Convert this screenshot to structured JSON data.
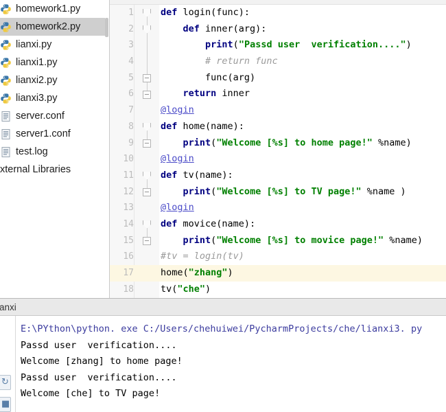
{
  "sidebar": {
    "items": [
      {
        "label": "homework1.py",
        "icon": "python-file-icon",
        "selected": false
      },
      {
        "label": "homework2.py",
        "icon": "python-file-icon",
        "selected": true
      },
      {
        "label": "lianxi.py",
        "icon": "python-file-icon",
        "selected": false
      },
      {
        "label": "lianxi1.py",
        "icon": "python-file-icon",
        "selected": false
      },
      {
        "label": "lianxi2.py",
        "icon": "python-file-icon",
        "selected": false
      },
      {
        "label": "lianxi3.py",
        "icon": "python-file-icon",
        "selected": false
      },
      {
        "label": "server.conf",
        "icon": "document-file-icon",
        "selected": false
      },
      {
        "label": "server1.conf",
        "icon": "document-file-icon",
        "selected": false
      },
      {
        "label": "test.log",
        "icon": "document-file-icon",
        "selected": false
      }
    ],
    "external_libraries": "xternal Libraries"
  },
  "editor": {
    "current_line": 17,
    "lines": [
      {
        "num": "1",
        "tokens": [
          {
            "t": "def ",
            "c": "t-kw"
          },
          {
            "t": "login",
            "c": "t-ident"
          },
          {
            "t": "(func):",
            "c": "t-op"
          }
        ]
      },
      {
        "num": "2",
        "tokens": [
          {
            "t": "    ",
            "c": "t-plain"
          },
          {
            "t": "def ",
            "c": "t-kw"
          },
          {
            "t": "inner",
            "c": "t-ident"
          },
          {
            "t": "(arg):",
            "c": "t-op"
          }
        ]
      },
      {
        "num": "3",
        "tokens": [
          {
            "t": "        ",
            "c": "t-plain"
          },
          {
            "t": "print",
            "c": "t-fn"
          },
          {
            "t": "(",
            "c": "t-op"
          },
          {
            "t": "\"Passd user  verification....\"",
            "c": "t-str"
          },
          {
            "t": ")",
            "c": "t-op"
          }
        ]
      },
      {
        "num": "4",
        "tokens": [
          {
            "t": "        ",
            "c": "t-plain"
          },
          {
            "t": "# return func",
            "c": "t-cmt"
          }
        ]
      },
      {
        "num": "5",
        "tokens": [
          {
            "t": "        ",
            "c": "t-plain"
          },
          {
            "t": "func(arg)",
            "c": "t-ident"
          }
        ]
      },
      {
        "num": "6",
        "tokens": [
          {
            "t": "    ",
            "c": "t-plain"
          },
          {
            "t": "return ",
            "c": "t-kw"
          },
          {
            "t": "inner",
            "c": "t-ident"
          }
        ]
      },
      {
        "num": "7",
        "tokens": [
          {
            "t": "@login",
            "c": "t-dec"
          }
        ]
      },
      {
        "num": "8",
        "tokens": [
          {
            "t": "def ",
            "c": "t-kw"
          },
          {
            "t": "home",
            "c": "t-ident"
          },
          {
            "t": "(name):",
            "c": "t-op"
          }
        ]
      },
      {
        "num": "9",
        "tokens": [
          {
            "t": "    ",
            "c": "t-plain"
          },
          {
            "t": "print",
            "c": "t-fn"
          },
          {
            "t": "(",
            "c": "t-op"
          },
          {
            "t": "\"Welcome [%s] to home page!\"",
            "c": "t-str"
          },
          {
            "t": " %name)",
            "c": "t-op"
          }
        ]
      },
      {
        "num": "10",
        "tokens": [
          {
            "t": "@login",
            "c": "t-dec"
          }
        ]
      },
      {
        "num": "11",
        "tokens": [
          {
            "t": "def ",
            "c": "t-kw"
          },
          {
            "t": "tv",
            "c": "t-ident"
          },
          {
            "t": "(name):",
            "c": "t-op"
          }
        ]
      },
      {
        "num": "12",
        "tokens": [
          {
            "t": "    ",
            "c": "t-plain"
          },
          {
            "t": "print",
            "c": "t-fn"
          },
          {
            "t": "(",
            "c": "t-op"
          },
          {
            "t": "\"Welcome [%s] to TV page!\"",
            "c": "t-str"
          },
          {
            "t": " %name )",
            "c": "t-op"
          }
        ]
      },
      {
        "num": "13",
        "tokens": [
          {
            "t": "@login",
            "c": "t-dec"
          }
        ]
      },
      {
        "num": "14",
        "tokens": [
          {
            "t": "def ",
            "c": "t-kw"
          },
          {
            "t": "movice",
            "c": "t-ident"
          },
          {
            "t": "(name):",
            "c": "t-op"
          }
        ]
      },
      {
        "num": "15",
        "tokens": [
          {
            "t": "    ",
            "c": "t-plain"
          },
          {
            "t": "print",
            "c": "t-fn"
          },
          {
            "t": "(",
            "c": "t-op"
          },
          {
            "t": "\"Welcome [%s] to movice page!\"",
            "c": "t-str"
          },
          {
            "t": " %name)",
            "c": "t-op"
          }
        ]
      },
      {
        "num": "16",
        "tokens": [
          {
            "t": "#tv = login(tv)",
            "c": "t-cmt"
          }
        ]
      },
      {
        "num": "17",
        "tokens": [
          {
            "t": "home(",
            "c": "t-op"
          },
          {
            "t": "\"zhang\"",
            "c": "t-str"
          },
          {
            "t": ")",
            "c": "t-op"
          }
        ]
      },
      {
        "num": "18",
        "tokens": [
          {
            "t": "tv(",
            "c": "t-op"
          },
          {
            "t": "\"che\"",
            "c": "t-str"
          },
          {
            "t": ")",
            "c": "t-op"
          }
        ]
      }
    ]
  },
  "console": {
    "tab_label": "ianxi",
    "rerun_icon": "rerun-icon",
    "stop_icon": "stop-icon",
    "lines": [
      {
        "text": "E:\\PYthon\\python. exe C:/Users/chehuiwei/PycharmProjects/che/lianxi3. py",
        "kind": "cmd"
      },
      {
        "text": "Passd user  verification....",
        "kind": "out"
      },
      {
        "text": "Welcome [zhang] to home page!",
        "kind": "out"
      },
      {
        "text": "Passd user  verification....",
        "kind": "out"
      },
      {
        "text": "Welcome [che] to TV page!",
        "kind": "out"
      }
    ]
  },
  "colors": {
    "keyword": "#000080",
    "string": "#008000",
    "comment": "#9a9a9a",
    "decorator": "#4a4ac8",
    "current_line_bg": "#fdf7e2",
    "selection_bg": "#cfcfcf",
    "gutter_bg": "#f7f7f7"
  }
}
